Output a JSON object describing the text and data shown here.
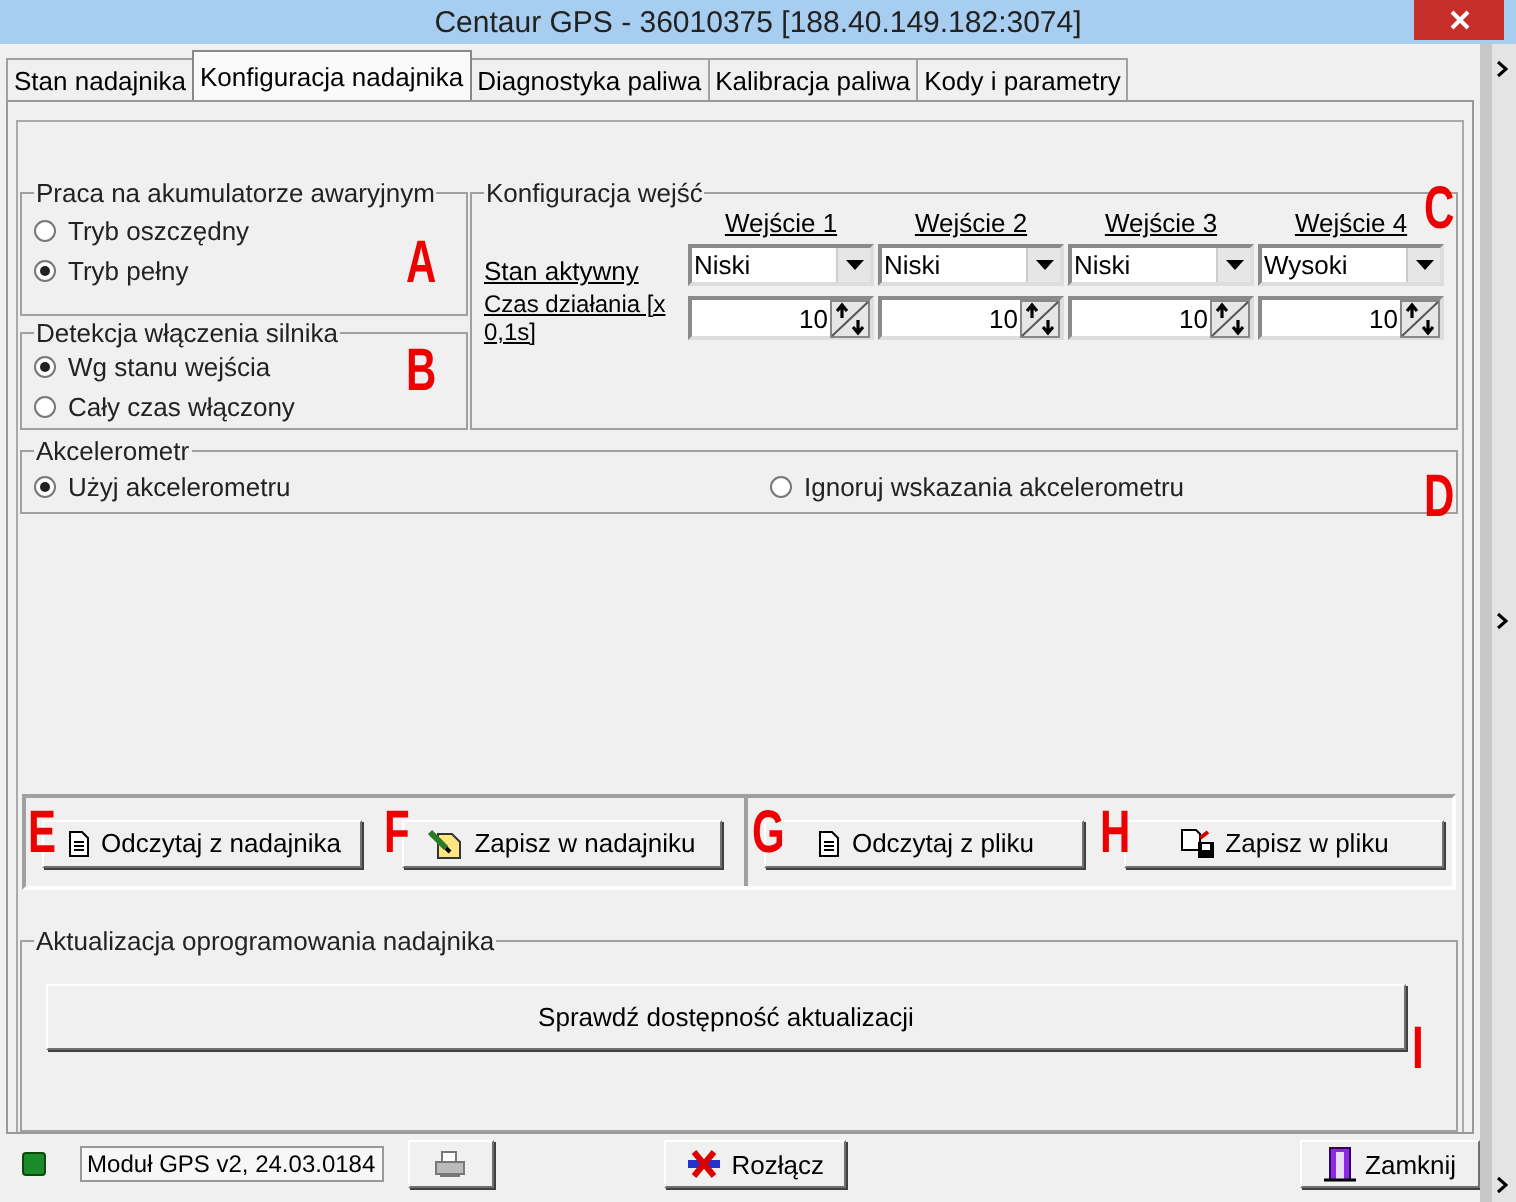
{
  "window": {
    "title": "Centaur GPS - 36010375 [188.40.149.182:3074]"
  },
  "tabs": [
    {
      "label": "Stan nadajnika",
      "selected": false
    },
    {
      "label": "Konfiguracja nadajnika",
      "selected": true
    },
    {
      "label": "Diagnostyka paliwa",
      "selected": false
    },
    {
      "label": "Kalibracja paliwa",
      "selected": false
    },
    {
      "label": "Kody i parametry",
      "selected": false
    }
  ],
  "battery_mode": {
    "title": "Praca na akumulatorze awaryjnym",
    "options": [
      {
        "label": "Tryb oszczędny",
        "selected": false
      },
      {
        "label": "Tryb pełny",
        "selected": true
      }
    ]
  },
  "engine_detection": {
    "title": "Detekcja włączenia silnika",
    "options": [
      {
        "label": "Wg stanu wejścia",
        "selected": true
      },
      {
        "label": "Cały czas włączony",
        "selected": false
      }
    ]
  },
  "inputs": {
    "title": "Konfiguracja wejść",
    "row_labels": [
      "Stan aktywny",
      "Czas działania [x 0,1s]"
    ],
    "columns": [
      {
        "header": "Wejście 1",
        "state": "Niski",
        "time": "10"
      },
      {
        "header": "Wejście 2",
        "state": "Niski",
        "time": "10"
      },
      {
        "header": "Wejście 3",
        "state": "Niski",
        "time": "10"
      },
      {
        "header": "Wejście 4",
        "state": "Wysoki",
        "time": "10"
      }
    ]
  },
  "accelerometer": {
    "title": "Akcelerometr",
    "options": [
      {
        "label": "Użyj akcelerometru",
        "selected": true
      },
      {
        "label": "Ignoruj wskazania akcelerometru",
        "selected": false
      }
    ]
  },
  "button_groups": [
    [
      {
        "label": "Odczytaj z nadajnika",
        "kind": "read"
      },
      {
        "label": "Zapisz w nadajniku",
        "kind": "write"
      }
    ],
    [
      {
        "label": "Odczytaj z pliku",
        "kind": "read"
      },
      {
        "label": "Zapisz w pliku",
        "kind": "save"
      }
    ]
  ],
  "update": {
    "title": "Aktualizacja oprogramowania nadajnika",
    "button": "Sprawdź dostępność aktualizacji"
  },
  "status_bar": {
    "module": "Moduł GPS v2, 24.03.0184",
    "disconnect": "Rozłącz",
    "close": "Zamknij"
  },
  "annotations": [
    "A",
    "B",
    "C",
    "D",
    "E",
    "F",
    "G",
    "H",
    "I"
  ]
}
